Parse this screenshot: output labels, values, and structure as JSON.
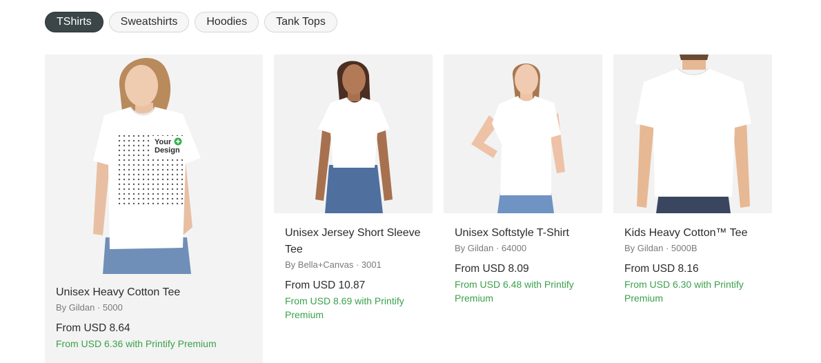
{
  "tabs": [
    {
      "label": "TShirts",
      "active": true
    },
    {
      "label": "Sweatshirts",
      "active": false
    },
    {
      "label": "Hoodies",
      "active": false
    },
    {
      "label": "Tank Tops",
      "active": false
    }
  ],
  "products": [
    {
      "title": "Unisex Heavy Cotton Tee",
      "meta": "By Gildan · 5000",
      "price": "From USD 8.64",
      "premium": "From USD 6.36 with Printify Premium",
      "image": "woman-tshirt-design-mockup",
      "design_label_line1": "Your",
      "design_label_line2": "Design"
    },
    {
      "title": "Unisex Jersey Short Sleeve Tee",
      "meta": "By Bella+Canvas · 3001",
      "price": "From USD 10.87",
      "premium": "From USD 8.69 with Printify Premium",
      "image": "woman-white-tee-jeans"
    },
    {
      "title": "Unisex Softstyle T-Shirt",
      "meta": "By Gildan · 64000",
      "price": "From USD 8.09",
      "premium": "From USD 6.48 with Printify Premium",
      "image": "woman-white-tee-hand-on-hip"
    },
    {
      "title": "Kids Heavy Cotton™ Tee",
      "meta": "By Gildan · 5000B",
      "price": "From USD 8.16",
      "premium": "From USD 6.30 with Printify Premium",
      "image": "kid-white-tee"
    }
  ],
  "colors": {
    "active_tab": "#3b4648",
    "premium_green": "#3aa14a",
    "plus_badge": "#33b24a"
  }
}
